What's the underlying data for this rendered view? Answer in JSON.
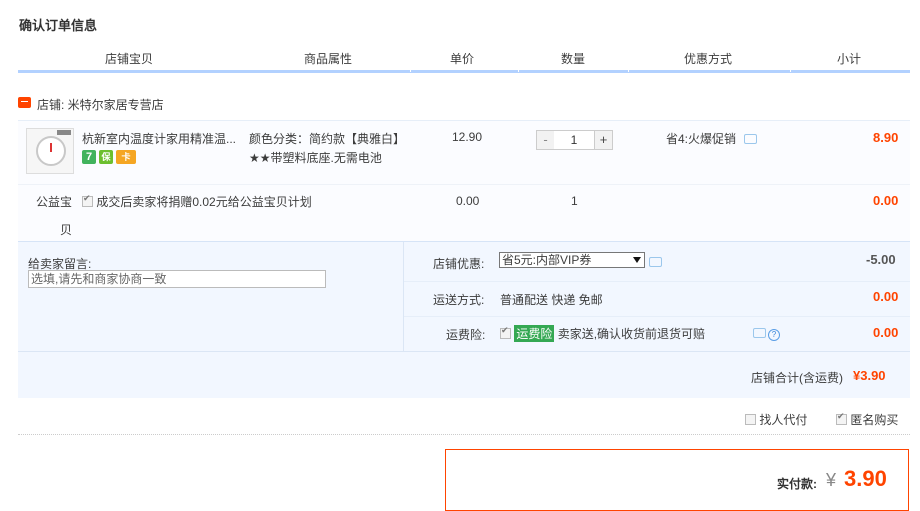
{
  "page_title": "确认订单信息",
  "columns": [
    "店铺宝贝",
    "商品属性",
    "单价",
    "数量",
    "优惠方式",
    "小计"
  ],
  "shop": {
    "label": "店铺: 米特尔家居专营店"
  },
  "item": {
    "name": "杭新室内温度计家用精准温...",
    "attr_line1": "颜色分类：简约款【典雅白】",
    "attr_line2": "★★带塑料底座.无需电池",
    "price": "12.90",
    "quantity": "1",
    "minus": "-",
    "plus": "+",
    "promo": "省4:火爆促销",
    "subtotal": "8.90",
    "service_icons": [
      "7",
      "保",
      "卡"
    ]
  },
  "charity": {
    "label_line1": "公益宝",
    "label_line2": "贝",
    "text": "成交后卖家将捐赠0.02元给公益宝贝计划",
    "checked": true,
    "price": "0.00",
    "quantity": "1",
    "subtotal": "0.00"
  },
  "message": {
    "label": "给卖家留言:",
    "value": "选填,请先和商家协商一致"
  },
  "shop_discount": {
    "label": "店铺优惠:",
    "selected": "省5元:内部VIP券",
    "amount": "-5.00"
  },
  "shipping": {
    "label": "运送方式:",
    "value": "普通配送 快递 免邮",
    "amount": "0.00"
  },
  "insurance": {
    "label": "运费险:",
    "tag": "运费险",
    "text": "卖家送,确认收货前退货可赔",
    "amount": "0.00",
    "help": "?"
  },
  "shop_total": {
    "label": "店铺合计(含运费)",
    "value": "¥3.90"
  },
  "options": {
    "proxy_label": "找人代付",
    "proxy_checked": false,
    "anon_label": "匿名购买",
    "anon_checked": true
  },
  "payment": {
    "label": "实付款:",
    "currency": "¥",
    "value": "3.90"
  },
  "colors": {
    "accent": "#ff4400",
    "header_line": "#b2d1ff",
    "panel_bg": "#f2f7ff",
    "tag_green": "#34a853"
  }
}
